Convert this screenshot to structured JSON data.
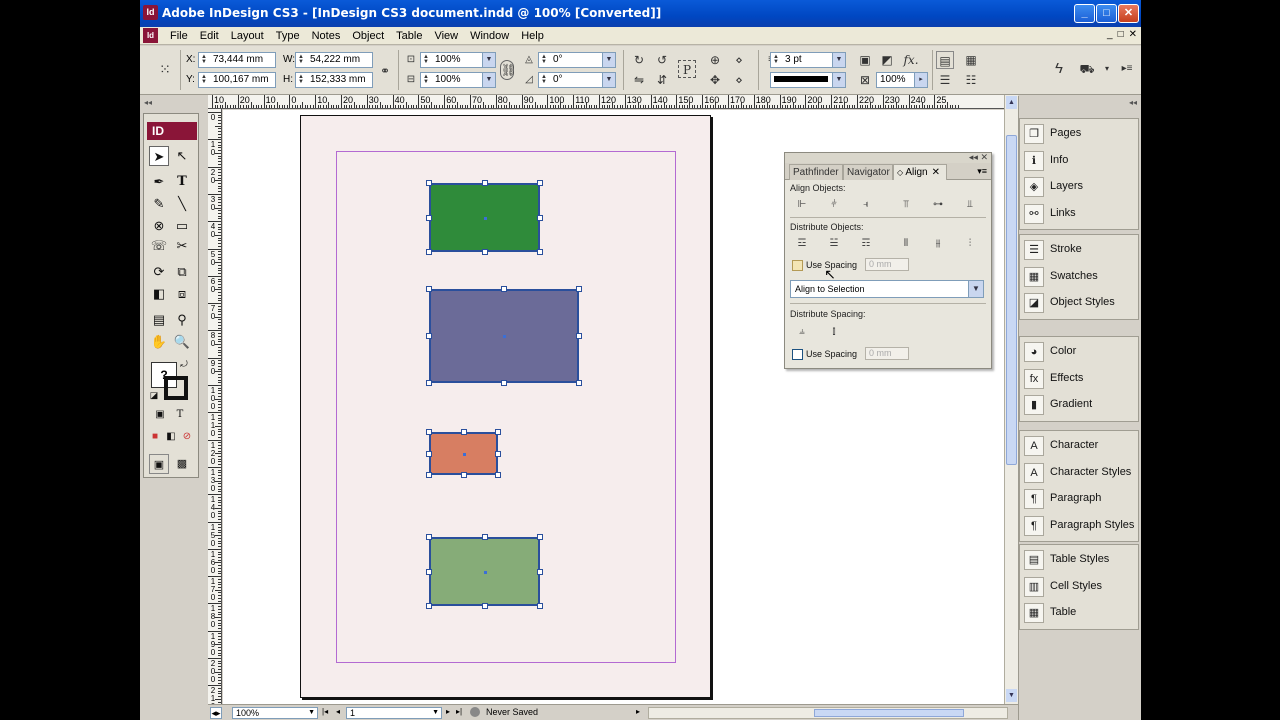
{
  "app": {
    "title": "Adobe InDesign CS3 - [InDesign CS3 document.indd @ 100% [Converted]]",
    "icon_text": "Id",
    "window_buttons": [
      "_",
      "□",
      "✕"
    ]
  },
  "menu": {
    "items": [
      "File",
      "Edit",
      "Layout",
      "Type",
      "Notes",
      "Object",
      "Table",
      "View",
      "Window",
      "Help"
    ],
    "mdi_buttons": [
      "_",
      "□",
      "✕"
    ]
  },
  "control": {
    "x_label": "X:",
    "x_value": "73,444 mm",
    "y_label": "Y:",
    "y_value": "100,167 mm",
    "w_label": "W:",
    "w_value": "54,222 mm",
    "h_label": "H:",
    "h_value": "152,333 mm",
    "scale_x": "100%",
    "scale_y": "100%",
    "rotate": "0°",
    "shear": "0°",
    "stroke_weight": "3 pt",
    "opacity": "100%"
  },
  "toolbox": {
    "logo": "ID",
    "tools": [
      "selection-tool-icon",
      "direct-selection-tool-icon",
      "pen-tool-icon",
      "type-tool-icon",
      "pencil-tool-icon",
      "line-tool-icon",
      "rectangle-frame-tool-icon",
      "rectangle-tool-icon",
      "button-tool-icon",
      "scissors-tool-icon",
      "rotate-tool-icon",
      "scale-tool-icon",
      "gradient-tool-icon",
      "free-transform-tool-icon",
      "note-tool-icon",
      "eyedropper-tool-icon",
      "hand-tool-icon",
      "zoom-tool-icon"
    ]
  },
  "rulers": {
    "top": [
      "10",
      "20",
      "10",
      "0",
      "10",
      "20",
      "30",
      "40",
      "50",
      "60",
      "70",
      "80",
      "90",
      "100",
      "110",
      "120",
      "130",
      "140",
      "150",
      "160",
      "170",
      "180",
      "190",
      "200",
      "210",
      "220",
      "230",
      "240",
      "25"
    ],
    "left": [
      "0",
      "1\n0",
      "2\n0",
      "3\n0",
      "4\n0",
      "5\n0",
      "6\n0",
      "7\n0",
      "8\n0",
      "9\n0",
      "1\n0\n0",
      "1\n1\n0",
      "1\n2\n0",
      "1\n3\n0",
      "1\n4\n0",
      "1\n5\n0",
      "1\n6\n0",
      "1\n7\n0",
      "1\n8\n0",
      "1\n9\n0",
      "2\n0\n0",
      "2\n1\n0"
    ]
  },
  "document": {
    "shapes": [
      {
        "name": "dark-green-rectangle",
        "color": "#2f8b3a"
      },
      {
        "name": "purple-gray-rectangle",
        "color": "#6b6b98"
      },
      {
        "name": "salmon-rectangle",
        "color": "#d77e62"
      },
      {
        "name": "light-green-rectangle",
        "color": "#86ac78"
      }
    ],
    "selection_color": "#2a4f9c",
    "margin_color": "#b36ad2",
    "page_color": "#f6eded"
  },
  "status": {
    "zoom": "100%",
    "page": "1",
    "save_state": "Never Saved"
  },
  "align_panel": {
    "tabs": [
      "Pathfinder",
      "Navigator",
      "Align"
    ],
    "active_tab": "Align",
    "align_objects_label": "Align Objects:",
    "distribute_objects_label": "Distribute Objects:",
    "use_spacing_label": "Use Spacing",
    "spacing_value": "0 mm",
    "align_to": "Align to Selection",
    "distribute_spacing_label": "Distribute Spacing:",
    "use_spacing_label_2": "Use Spacing",
    "spacing_value_2": "0 mm"
  },
  "dock": {
    "groups": [
      [
        {
          "label": "Pages",
          "icon": "pages-icon"
        },
        {
          "label": "Info",
          "icon": "info-icon"
        },
        {
          "label": "Layers",
          "icon": "layers-icon"
        },
        {
          "label": "Links",
          "icon": "links-icon"
        }
      ],
      [
        {
          "label": "Stroke",
          "icon": "stroke-icon"
        },
        {
          "label": "Swatches",
          "icon": "swatches-icon"
        },
        {
          "label": "Object Styles",
          "icon": "object-styles-icon"
        }
      ],
      [
        {
          "label": "Color",
          "icon": "color-icon"
        },
        {
          "label": "Effects",
          "icon": "effects-icon"
        },
        {
          "label": "Gradient",
          "icon": "gradient-icon"
        }
      ],
      [
        {
          "label": "Character",
          "icon": "character-icon"
        },
        {
          "label": "Character Styles",
          "icon": "character-styles-icon"
        },
        {
          "label": "Paragraph",
          "icon": "paragraph-icon"
        },
        {
          "label": "Paragraph Styles",
          "icon": "paragraph-styles-icon"
        }
      ],
      [
        {
          "label": "Table Styles",
          "icon": "table-styles-icon"
        },
        {
          "label": "Cell Styles",
          "icon": "cell-styles-icon"
        },
        {
          "label": "Table",
          "icon": "table-icon"
        }
      ]
    ]
  }
}
